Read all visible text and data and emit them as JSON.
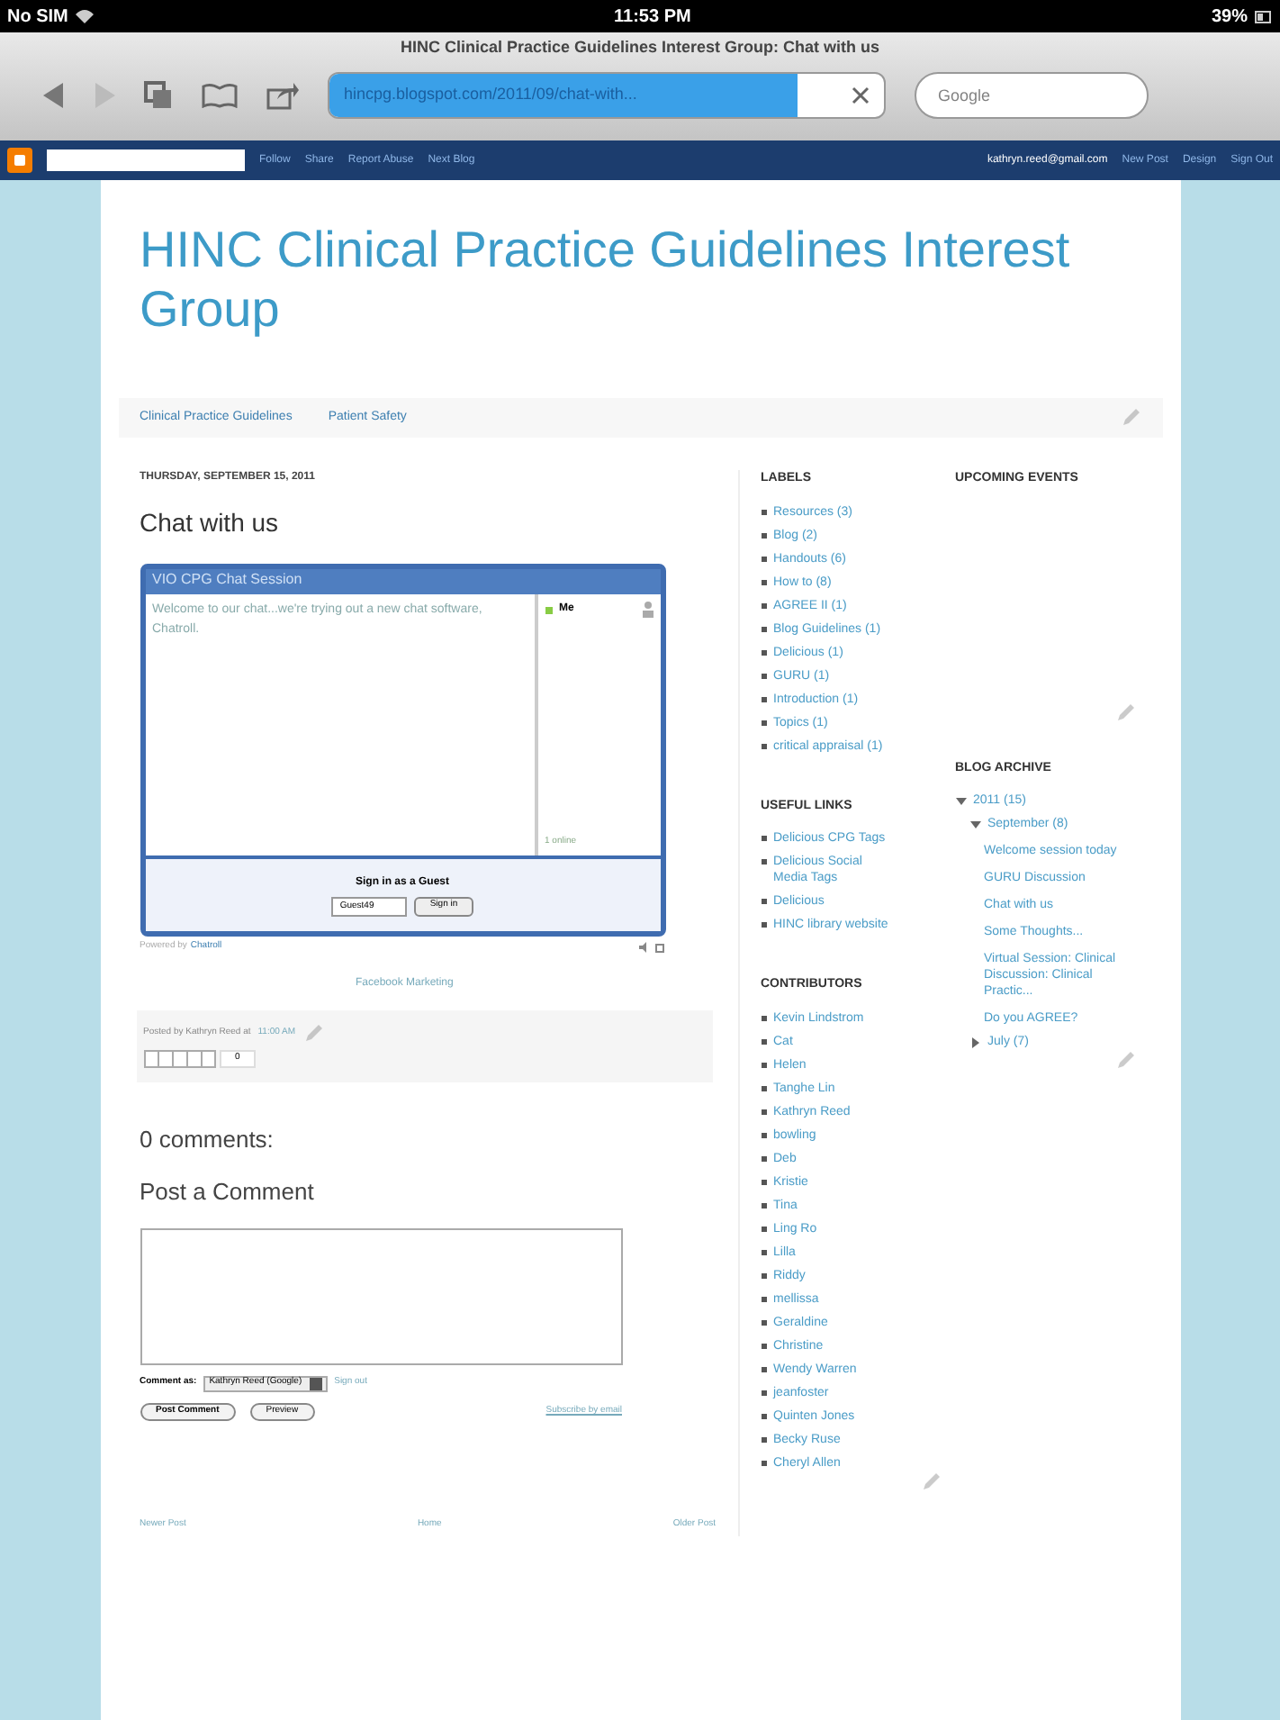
{
  "status_bar": {
    "carrier": "No SIM",
    "time": "11:53 PM",
    "battery": "39%"
  },
  "browser": {
    "title": "HINC Clinical Practice Guidelines Interest Group: Chat with us",
    "url": "hincpg.blogspot.com/2011/09/chat-with...",
    "search": {
      "placeholder": "Google"
    }
  },
  "navbar": {
    "links": [
      "Follow",
      "Share",
      "Report Abuse",
      "Next Blog"
    ],
    "email": "kathryn.reed@gmail.com",
    "right_links": [
      "New Post",
      "Design",
      "Sign Out"
    ]
  },
  "blog": {
    "title": "HINC Clinical Practice Guidelines Interest Group",
    "tabs": [
      "Clinical Practice Guidelines",
      "Patient Safety"
    ]
  },
  "post": {
    "date": "THURSDAY, SEPTEMBER 15, 2011",
    "title": "Chat with us",
    "chat": {
      "title": "VIO CPG Chat Session",
      "message": "Welcome to our chat...we're trying out a new chat software, Chatroll.",
      "user": "Me",
      "online": "1 online",
      "sign_in_label": "Sign in as a Guest",
      "guest_name": "Guest49",
      "sign_in_button": "Sign in",
      "powered_by": "Powered by",
      "powered_link": "Chatroll"
    },
    "ad_link": "Facebook Marketing",
    "posted_by": "Posted by Kathryn Reed at",
    "posted_time": "11:00 AM",
    "count": "0"
  },
  "comments": {
    "heading": "0 comments:",
    "post_heading": "Post a Comment",
    "comment_as": "Comment as:",
    "account": "Kathryn Reed (Google)",
    "sign_out": "Sign out",
    "buttons": [
      "Post Comment",
      "Preview"
    ],
    "subscribe": "Subscribe by email"
  },
  "labels": {
    "title": "LABELS",
    "items": [
      "Resources (3)",
      "Blog (2)",
      "Handouts (6)",
      "How to (8)",
      "AGREE II (1)",
      "Blog Guidelines (1)",
      "Delicious (1)",
      "GURU (1)",
      "Introduction (1)",
      "Topics (1)",
      "critical appraisal (1)"
    ]
  },
  "useful_links": {
    "title": "USEFUL LINKS",
    "items": [
      "Delicious CPG Tags",
      "Delicious Social Media Tags",
      "Delicious",
      "HINC library website"
    ]
  },
  "contributors": {
    "title": "CONTRIBUTORS",
    "items": [
      "Kevin Lindstrom",
      "Cat",
      "Helen",
      "Tanghe Lin",
      "Kathryn Reed",
      "bowling",
      "Deb",
      "Kristie",
      "Tina",
      "Ling Ro",
      "Lilla",
      "Riddy",
      "mellissa",
      "Geraldine",
      "Christine",
      "Wendy Warren",
      "jeanfoster",
      "Quinten Jones",
      "Becky Ruse",
      "Cheryl Allen"
    ]
  },
  "upcoming_events": {
    "title": "UPCOMING EVENTS"
  },
  "archive": {
    "title": "BLOG ARCHIVE",
    "years": [
      {
        "label": "2011 (15)",
        "expanded": true,
        "months": [
          {
            "label": "September (8)",
            "expanded": true,
            "posts": [
              "Welcome session today",
              "GURU Discussion",
              "Chat with us",
              "Some Thoughts...",
              "Virtual Session: Clinical Discussion: Clinical Practic...",
              "Do you AGREE?"
            ]
          },
          {
            "label": "July (7)",
            "expanded": false
          }
        ]
      }
    ]
  },
  "footer": {
    "links": [
      "Newer Post",
      "Home",
      "Older Post"
    ]
  }
}
